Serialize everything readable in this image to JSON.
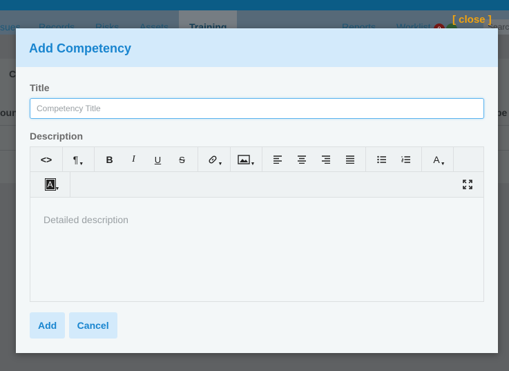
{
  "background": {
    "nav_items": [
      "sues",
      "Records",
      "Risks",
      "Assets",
      "Training",
      "Reports",
      "Worklist"
    ],
    "search_placeholder": "Searc",
    "badge_count": "0",
    "side_text_1": "C",
    "side_text_2": "oun",
    "side_text_3": "pe"
  },
  "close_link": "[ close ]",
  "modal": {
    "title": "Add Competency",
    "title_label": "Title",
    "title_placeholder": "Competency Title",
    "title_value": "",
    "description_label": "Description",
    "description_placeholder": "Detailed description",
    "add_button": "Add",
    "cancel_button": "Cancel"
  },
  "toolbar": {
    "code_view": "<>",
    "paragraph": "¶",
    "bold": "B",
    "italic": "I",
    "underline": "U",
    "strikethrough": "S",
    "font_color": "A",
    "background_color": "A"
  },
  "colors": {
    "accent": "#1985cf",
    "header_bg": "#d3eafb",
    "close_link": "#f2a30f",
    "input_focus": "#5ab3ef"
  }
}
